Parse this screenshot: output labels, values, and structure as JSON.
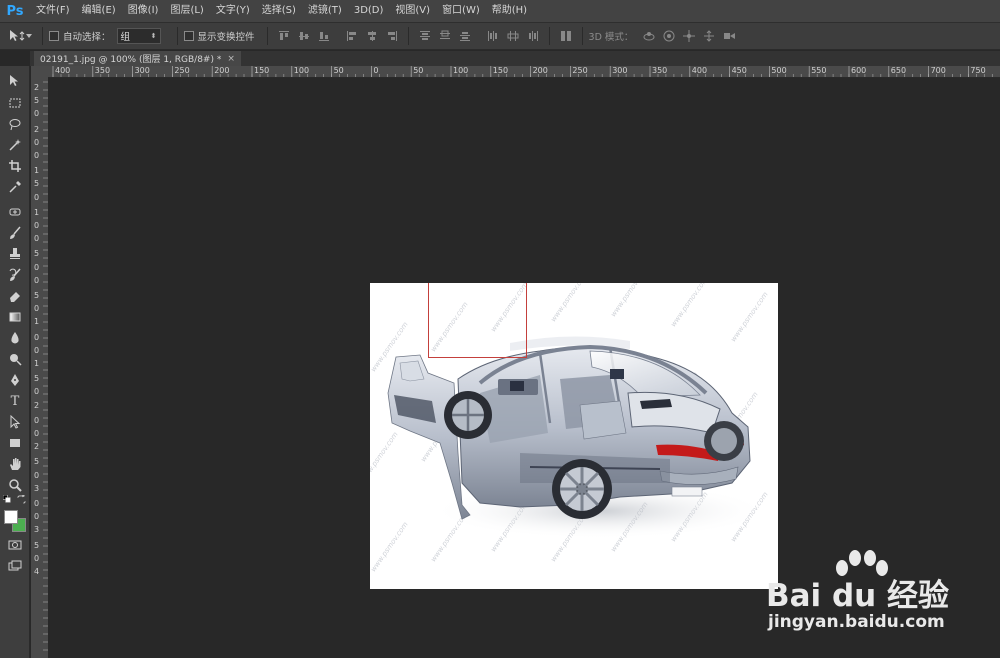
{
  "app": {
    "logo": "Ps",
    "menu": [
      "文件(F)",
      "编辑(E)",
      "图像(I)",
      "图层(L)",
      "文字(Y)",
      "选择(S)",
      "滤镜(T)",
      "3D(D)",
      "视图(V)",
      "窗口(W)",
      "帮助(H)"
    ]
  },
  "options": {
    "auto_select_label": "自动选择：",
    "group_value": "组",
    "show_transform_label": "显示变换控件",
    "mode3d_label": "3D 模式："
  },
  "document": {
    "tab_title": "02191_1.jpg @ 100% (图层 1, RGB/8#) *",
    "tab_close": "×"
  },
  "rulers": {
    "top": [
      "400",
      "350",
      "300",
      "250",
      "200",
      "150",
      "100",
      "50",
      "0",
      "50",
      "100",
      "150",
      "200",
      "250",
      "300",
      "350",
      "400",
      "450",
      "500",
      "550",
      "600",
      "650",
      "700",
      "750"
    ],
    "left": [
      "2",
      "5",
      "0",
      "2",
      "0",
      "0",
      "1",
      "5",
      "0",
      "1",
      "0",
      "0",
      "5",
      "0",
      "0",
      "5",
      "0",
      "1",
      "0",
      "0",
      "1",
      "5",
      "0",
      "2",
      "0",
      "0",
      "2",
      "5",
      "0",
      "3",
      "0",
      "0",
      "3",
      "5",
      "0",
      "4"
    ]
  },
  "watermark": {
    "image_text": "www.psmov.com",
    "baidu_main": "Bai du 经验",
    "baidu_url": "jingyan.baidu.com"
  },
  "colors": {
    "foreground": "#ffffff",
    "background": "#4caf50",
    "selection": "#c4403c"
  },
  "icons": [
    "move-tool-icon",
    "marquee-tool-icon",
    "lasso-tool-icon",
    "magic-wand-icon",
    "crop-tool-icon",
    "eyedropper-icon",
    "healing-brush-icon",
    "brush-tool-icon",
    "clone-stamp-icon",
    "history-brush-icon",
    "eraser-icon",
    "gradient-icon",
    "blur-icon",
    "dodge-icon",
    "pen-tool-icon",
    "type-tool-icon",
    "path-select-icon",
    "rectangle-tool-icon",
    "hand-tool-icon",
    "zoom-tool-icon",
    "quick-mask-icon",
    "screen-mode-icon"
  ]
}
